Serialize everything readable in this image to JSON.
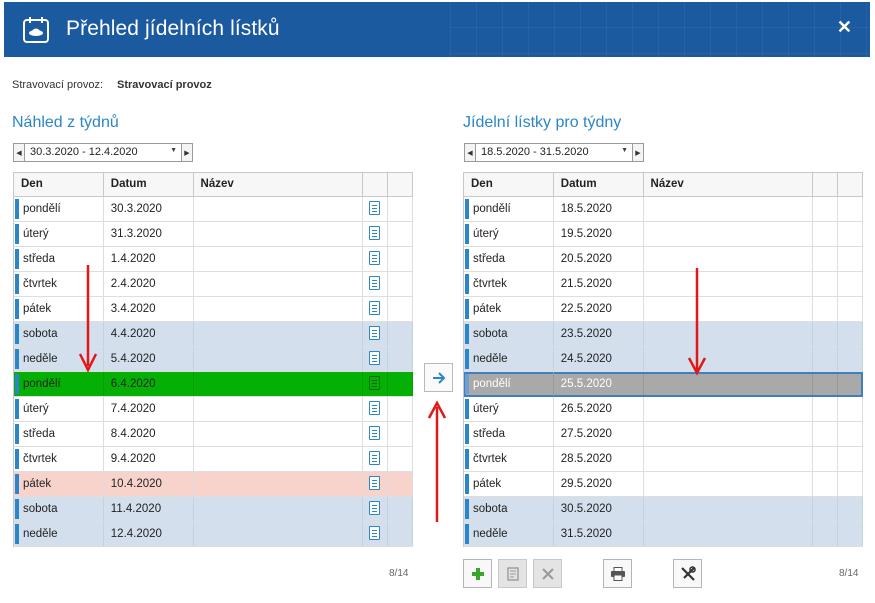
{
  "window": {
    "title": "Přehled jídelních lístků",
    "close_glyph": "✕",
    "icon": "calendar-plate-icon"
  },
  "provoz": {
    "label": "Stravovací provoz:",
    "value": "Stravovací provoz"
  },
  "left": {
    "title": "Náhled z týdnů",
    "week_range": "30.3.2020 - 12.4.2020",
    "columns": [
      "Den",
      "Datum",
      "Název"
    ],
    "rows": [
      {
        "den": "pondělí",
        "datum": "30.3.2020",
        "nazev": "",
        "state": "normal"
      },
      {
        "den": "úterý",
        "datum": "31.3.2020",
        "nazev": "",
        "state": "normal"
      },
      {
        "den": "středa",
        "datum": "1.4.2020",
        "nazev": "",
        "state": "normal"
      },
      {
        "den": "čtvrtek",
        "datum": "2.4.2020",
        "nazev": "",
        "state": "normal"
      },
      {
        "den": "pátek",
        "datum": "3.4.2020",
        "nazev": "",
        "state": "normal"
      },
      {
        "den": "sobota",
        "datum": "4.4.2020",
        "nazev": "",
        "state": "weekend"
      },
      {
        "den": "neděle",
        "datum": "5.4.2020",
        "nazev": "",
        "state": "weekend"
      },
      {
        "den": "pondělí",
        "datum": "6.4.2020",
        "nazev": "",
        "state": "current"
      },
      {
        "den": "úterý",
        "datum": "7.4.2020",
        "nazev": "",
        "state": "normal"
      },
      {
        "den": "středa",
        "datum": "8.4.2020",
        "nazev": "",
        "state": "normal"
      },
      {
        "den": "čtvrtek",
        "datum": "9.4.2020",
        "nazev": "",
        "state": "normal"
      },
      {
        "den": "pátek",
        "datum": "10.4.2020",
        "nazev": "",
        "state": "holiday"
      },
      {
        "den": "sobota",
        "datum": "11.4.2020",
        "nazev": "",
        "state": "weekend"
      },
      {
        "den": "neděle",
        "datum": "12.4.2020",
        "nazev": "",
        "state": "weekend"
      }
    ],
    "pager": "8/14"
  },
  "right": {
    "title": "Jídelní lístky pro týdny",
    "week_range": "18.5.2020 - 31.5.2020",
    "columns": [
      "Den",
      "Datum",
      "Název"
    ],
    "rows": [
      {
        "den": "pondělí",
        "datum": "18.5.2020",
        "nazev": "",
        "state": "normal"
      },
      {
        "den": "úterý",
        "datum": "19.5.2020",
        "nazev": "",
        "state": "normal"
      },
      {
        "den": "středa",
        "datum": "20.5.2020",
        "nazev": "",
        "state": "normal"
      },
      {
        "den": "čtvrtek",
        "datum": "21.5.2020",
        "nazev": "",
        "state": "normal"
      },
      {
        "den": "pátek",
        "datum": "22.5.2020",
        "nazev": "",
        "state": "normal"
      },
      {
        "den": "sobota",
        "datum": "23.5.2020",
        "nazev": "",
        "state": "weekend"
      },
      {
        "den": "neděle",
        "datum": "24.5.2020",
        "nazev": "",
        "state": "weekend"
      },
      {
        "den": "pondělí",
        "datum": "25.5.2020",
        "nazev": "",
        "state": "selected"
      },
      {
        "den": "úterý",
        "datum": "26.5.2020",
        "nazev": "",
        "state": "normal"
      },
      {
        "den": "středa",
        "datum": "27.5.2020",
        "nazev": "",
        "state": "normal"
      },
      {
        "den": "čtvrtek",
        "datum": "28.5.2020",
        "nazev": "",
        "state": "normal"
      },
      {
        "den": "pátek",
        "datum": "29.5.2020",
        "nazev": "",
        "state": "normal"
      },
      {
        "den": "sobota",
        "datum": "30.5.2020",
        "nazev": "",
        "state": "weekend"
      },
      {
        "den": "neděle",
        "datum": "31.5.2020",
        "nazev": "",
        "state": "weekend"
      }
    ],
    "pager": "8/14",
    "toolbar": [
      "add-icon",
      "edit-menu-icon",
      "delete-icon",
      "print-icon",
      "settings-tools-icon"
    ]
  },
  "colors": {
    "accent": "#2a86c8",
    "title_bar": "#1c5aa0",
    "weekend_row": "#d3dfec",
    "current_row": "#05b005",
    "holiday_row": "#f8d3cb",
    "selected_row": "#a9a9a9",
    "annotation_arrow": "#e01818"
  }
}
